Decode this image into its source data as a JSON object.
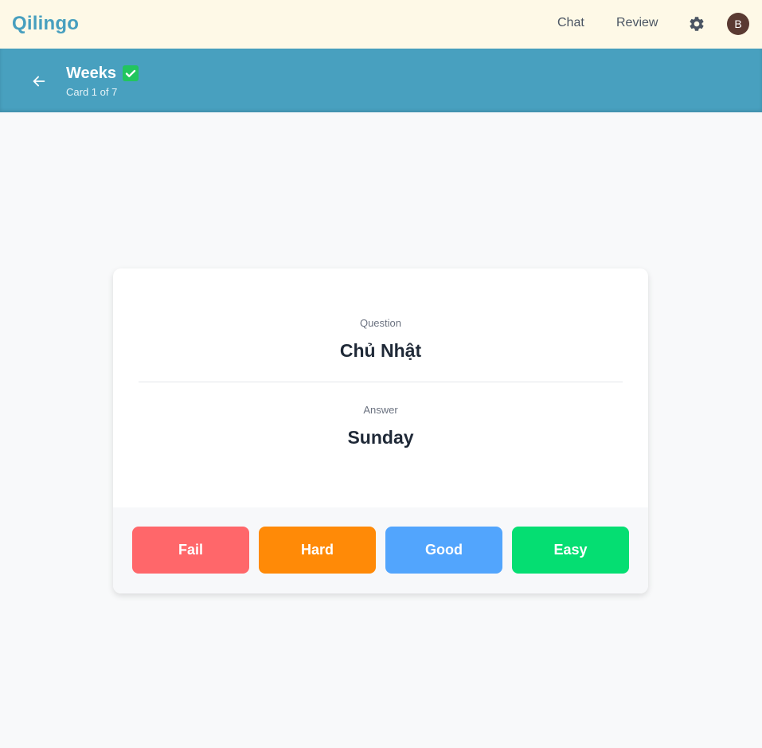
{
  "header": {
    "brand": "Qilingo",
    "nav": [
      {
        "label": "Chat"
      },
      {
        "label": "Review"
      }
    ],
    "settings_icon": "gear-icon",
    "avatar_initial": "B"
  },
  "deck": {
    "back_icon": "arrow-left-icon",
    "title": "Weeks",
    "status_icon": "check-icon",
    "progress": "Card 1 of 7"
  },
  "card": {
    "question_label": "Question",
    "question": "Chủ Nhật",
    "answer_label": "Answer",
    "answer": "Sunday"
  },
  "ratings": [
    {
      "label": "Fail",
      "color": "#ff676a"
    },
    {
      "label": "Hard",
      "color": "#ff8a07"
    },
    {
      "label": "Good",
      "color": "#52a5fd"
    },
    {
      "label": "Easy",
      "color": "#05de72"
    }
  ],
  "colors": {
    "brand": "#479fbf",
    "topbar_bg": "#fef9e7",
    "deckbar_bg": "#48a0bf"
  }
}
